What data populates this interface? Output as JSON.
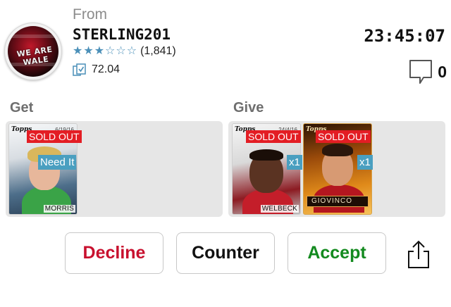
{
  "header": {
    "from_label": "From",
    "username": "STERLING201",
    "avatar_text": "WE ARE WALE",
    "rating": {
      "stars_filled": 3,
      "stars_total": 6,
      "count": "(1,841)"
    },
    "score": "72.04",
    "timer": "23:45:07",
    "comments": "0"
  },
  "get": {
    "label": "Get",
    "cards": [
      {
        "player": "MORRIS",
        "date": "6/19/16",
        "brand": "Topps",
        "badge": "SOLD OUT",
        "tag": "Need It",
        "style": "blue"
      }
    ]
  },
  "give": {
    "label": "Give",
    "cards": [
      {
        "player": "WELBECK",
        "date": "24/4/16",
        "brand": "Topps",
        "badge": "SOLD OUT",
        "tag": "x1",
        "style": "red"
      },
      {
        "player": "GIOVINCO",
        "date": "",
        "brand": "Topps",
        "badge": "SOLD OUT",
        "tag": "x1",
        "style": "orange"
      }
    ]
  },
  "actions": {
    "decline": "Decline",
    "counter": "Counter",
    "accept": "Accept"
  },
  "colors": {
    "decline": "#c8102e",
    "accept": "#138a1f",
    "sold_out": "#e31d24",
    "tag": "#4a9fc0",
    "star": "#4a8fb8"
  },
  "icons": {
    "score": "card-collection-icon",
    "comments": "speech-bubble-icon",
    "share": "share-icon"
  }
}
